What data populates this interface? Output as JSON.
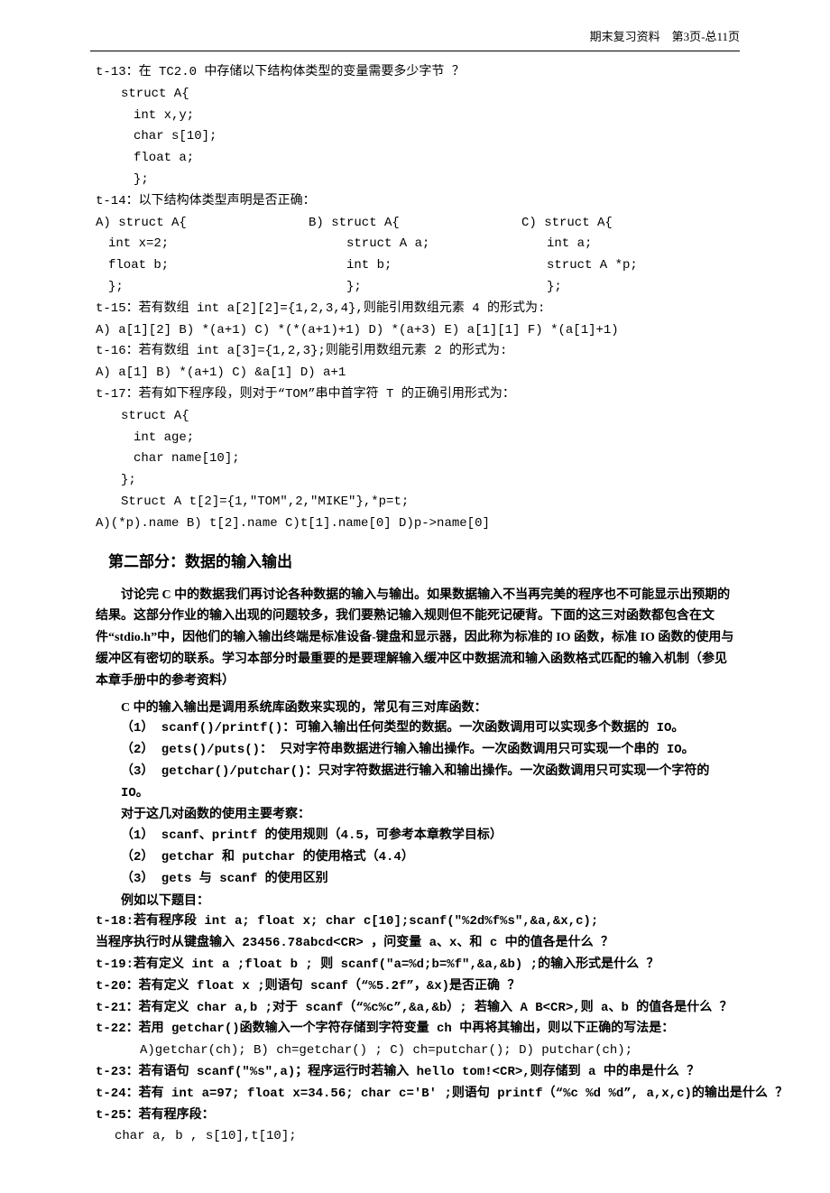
{
  "header": {
    "label": "期末复习资料",
    "page_prefix": "第",
    "page_num": "3",
    "page_mid": "页-总",
    "page_total": "11",
    "page_suffix": "页"
  },
  "t13": {
    "q": "t-13：在 TC2.0 中存储以下结构体类型的变量需要多少字节 ？",
    "l1": "struct  A{",
    "l2": "int x,y;",
    "l3": "char s[10];",
    "l4": "float a;",
    "l5": "};"
  },
  "t14": {
    "q": "t-14：以下结构体类型声明是否正确：",
    "a": {
      "h": "A) struct A{",
      "l1": "int x=2;",
      "l2": "float b;",
      "l3": "};"
    },
    "b": {
      "h": "B)  struct A{",
      "l1": "struct  A  a;",
      "l2": "int b;",
      "l3": "};"
    },
    "c": {
      "h": "C) struct A{",
      "l1": "int a;",
      "l2": "struct A *p;",
      "l3": "};"
    }
  },
  "t15": {
    "q": "t-15：若有数组 int a[2][2]={1,2,3,4},则能引用数组元素 4 的形式为:",
    "opts": "A) a[1][2]    B) *(a+1)    C) *(*(a+1)+1)    D) *(a+3)   E) a[1][1]    F) *(a[1]+1)"
  },
  "t16": {
    "q": "t-16：若有数组 int a[3]={1,2,3};则能引用数组元素 2 的形式为:",
    "opts": " A) a[1]    B) *(a+1)    C) &a[1]    D) a+1"
  },
  "t17": {
    "q": "t-17：若有如下程序段，则对于“TOM”串中首字符 T 的正确引用形式为：",
    "l1": "struct A{",
    "l2": "int age;",
    "l3": "char name[10];",
    "l4": "};",
    "l5": "Struct A t[2]={1,\"TOM\",2,\"MIKE\"},*p=t;",
    "opts": "A)(*p).name    B) t[2].name    C)t[1].name[0]    D)p->name[0]"
  },
  "section2": {
    "title": "第二部分：数据的输入输出",
    "p1": "讨论完 C 中的数据我们再讨论各种数据的输入与输出。如果数据输入不当再完美的程序也不可能显示出预期的结果。这部分作业的输入出现的问题较多，我们要熟记输入规则但不能死记硬背。下面的这三对函数都包含在文件“stdio.h”中，因他们的输入输出终端是标准设备-键盘和显示器，因此称为标准的 IO 函数，标准 IO 函数的使用与缓冲区有密切的联系。学习本部分时最重要的是要理解输入缓冲区中数据流和输入函数格式匹配的输入机制（参见本章手册中的参考资料）"
  },
  "lib": {
    "intro": "C 中的输入输出是调用系统库函数来实现的，常见有三对库函数：",
    "i1": "（1）  scanf()/printf()：可输入输出任何类型的数据。一次函数调用可以实现多个数据的 IO。",
    "i2": "（2）  gets()/puts()：  只对字符串数据进行输入输出操作。一次函数调用只可实现一个串的 IO。",
    "i3": "（3）  getchar()/putchar()：只对字符数据进行输入和输出操作。一次函数调用只可实现一个字符的 IO。"
  },
  "exam": {
    "intro": "对于这几对函数的使用主要考察：",
    "i1": "（1）  scanf、printf 的使用规则（4.5，可参考本章教学目标）",
    "i2": "（2）  getchar 和 putchar 的使用格式（4.4）",
    "i3": "（3）  gets 与 scanf 的使用区别"
  },
  "examples_title": "例如以下题目：",
  "t18": {
    "q": "t-18:若有程序段 int a; float x; char c[10];scanf(\"%2d%f%s\",&a,&x,c);",
    "q2": "当程序执行时从键盘输入 23456.78abcd<CR> ，问变量 a、x、和 c 中的值各是什么 ？"
  },
  "t19": "t-19:若有定义 int a ;float b ; 则 scanf(\"a=%d;b=%f\",&a,&b) ;的输入形式是什么 ？",
  "t20": "t-20：若有定义 float x ;则语句 scanf（“%5.2f”，&x)是否正确 ？",
  "t21": "t-21：若有定义 char a,b ;对于 scanf（“%c%c”,&a,&b）; 若输入 A  B<CR>,则 a、b 的值各是什么 ？",
  "t22": {
    "q": "t-22：若用 getchar()函数输入一个字符存储到字符变量 ch 中再将其输出，则以下正确的写法是：",
    "opts": "A)getchar(ch);  B) ch=getchar() ; C) ch=putchar();  D) putchar(ch);"
  },
  "t23": "t-23：若有语句 scanf(\"%s\",a)；程序运行时若输入 hello  tom!<CR>,则存储到 a 中的串是什么 ？",
  "t24": "t-24：若有 int a=97; float x=34.56; char c='B' ;则语句 printf（“%c %d %d”, a,x,c)的输出是什么 ？",
  "t25": {
    "q": "t-25：若有程序段：",
    "l1": "char a, b , s[10],t[10];"
  }
}
